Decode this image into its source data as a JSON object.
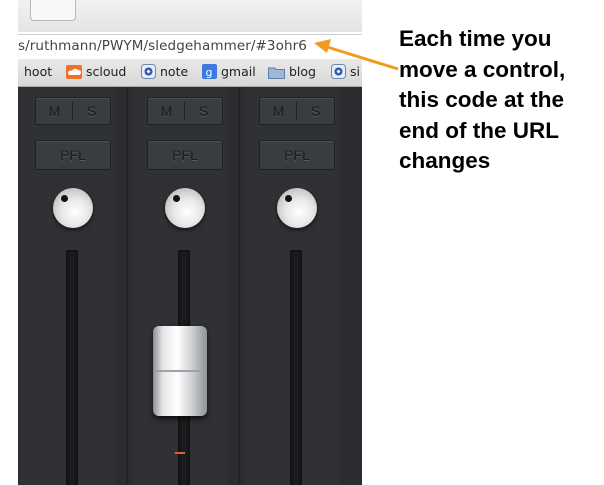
{
  "browser": {
    "url_fragment": "s/ruthmann/PWYM/sledgehammer/#3ohr6",
    "bookmarks": [
      {
        "label": "hoot",
        "icon": "none"
      },
      {
        "label": "scloud",
        "icon": "soundcloud-icon"
      },
      {
        "label": "note",
        "icon": "note-icon"
      },
      {
        "label": "gmail",
        "icon": "google-icon"
      },
      {
        "label": "blog",
        "icon": "folder-icon"
      },
      {
        "label": "si",
        "icon": "note-icon"
      }
    ]
  },
  "mixer": {
    "channels": [
      {
        "mute_label": "M",
        "solo_label": "S",
        "pfl_label": "PFL",
        "fader_level": 0.0,
        "has_fader": false
      },
      {
        "mute_label": "M",
        "solo_label": "S",
        "pfl_label": "PFL",
        "fader_level": 0.45,
        "has_fader": true
      },
      {
        "mute_label": "M",
        "solo_label": "S",
        "pfl_label": "PFL",
        "fader_level": 0.0,
        "has_fader": false
      }
    ]
  },
  "annotation": {
    "lines": [
      "Each time you",
      "move a control,",
      "this code at the",
      "end of the URL",
      "changes"
    ],
    "arrow_color": "#f39a1e"
  },
  "colors": {
    "mixer_bg": "#2b2d30",
    "meter": "#d5643a"
  }
}
